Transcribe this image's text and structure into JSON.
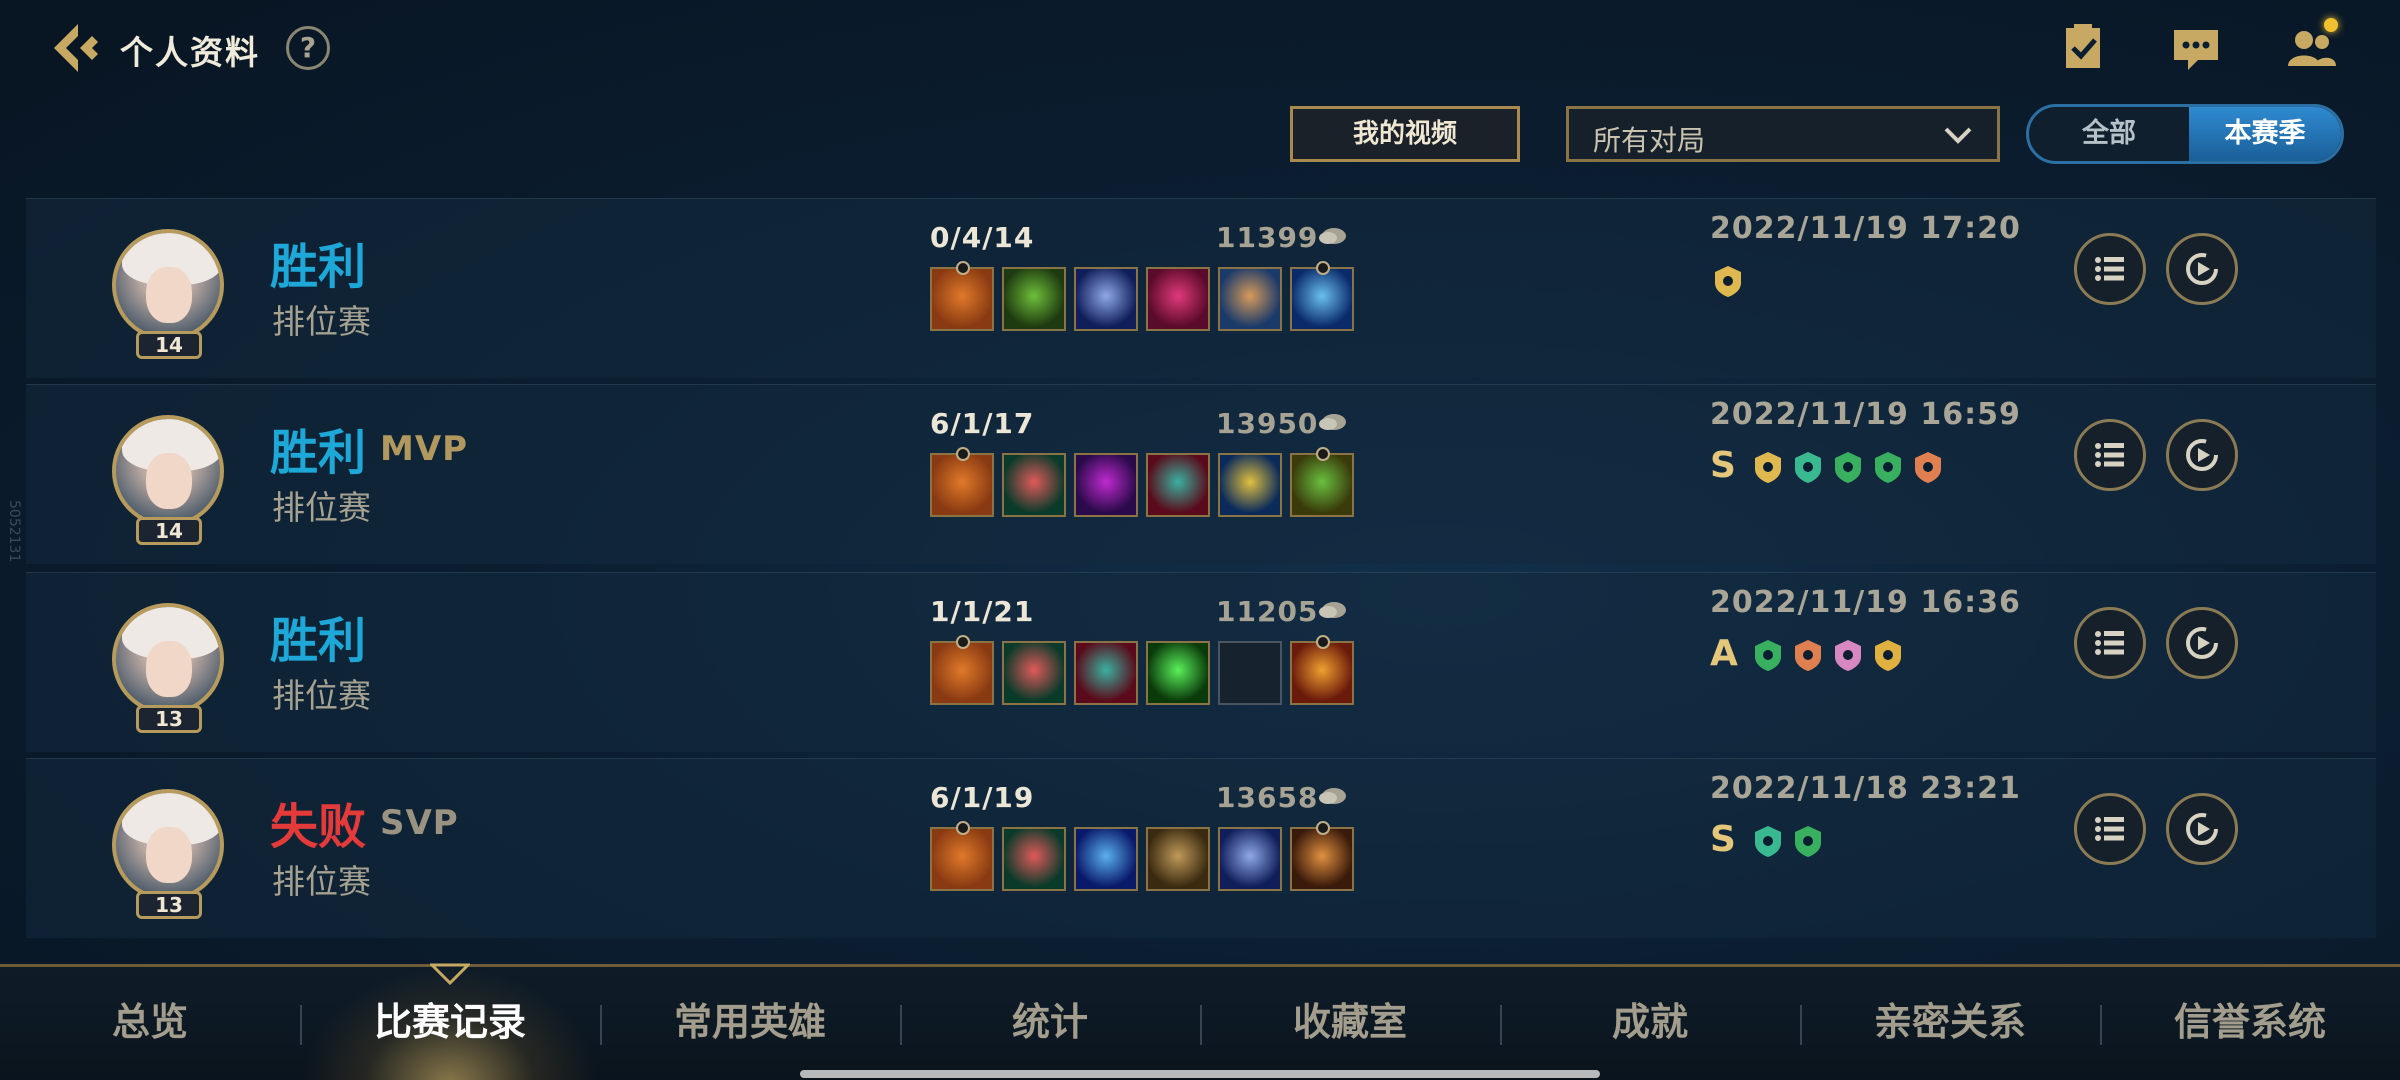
{
  "header": {
    "title": "个人资料",
    "help_label": "?"
  },
  "filters": {
    "my_videos_label": "我的视频",
    "match_type_selected": "所有对局",
    "segment": {
      "all_label": "全部",
      "season_label": "本赛季",
      "selected": "本赛季"
    }
  },
  "watermark": "5052131",
  "matches": [
    {
      "result": "胜利",
      "honor": "",
      "mode": "排位赛",
      "level": "14",
      "kda": "0/4/14",
      "gold": "11399",
      "time": "2022/11/19 17:20",
      "grade": "",
      "items": [
        "item-axe",
        "item-claw",
        "item-helm",
        "item-demon",
        "item-tome",
        "item-orb"
      ],
      "badges": [
        "gold-bee-badge"
      ]
    },
    {
      "result": "胜利",
      "honor": "MVP",
      "mode": "排位赛",
      "level": "14",
      "kda": "6/1/17",
      "gold": "13950",
      "time": "2022/11/19 16:59",
      "grade": "S",
      "items": [
        "item-axe",
        "item-boots",
        "item-mask",
        "item-beast",
        "item-trident",
        "item-scroll"
      ],
      "badges": [
        "gold-bee-badge",
        "green-shield-badge",
        "green-heart-badge",
        "green-armor-badge",
        "orange-tank-badge"
      ]
    },
    {
      "result": "胜利",
      "honor": "",
      "mode": "排位赛",
      "level": "13",
      "kda": "1/1/21",
      "gold": "11205",
      "time": "2022/11/19 16:36",
      "grade": "A",
      "items": [
        "item-axe",
        "item-boots",
        "item-beast",
        "item-skull-ring",
        "empty",
        "item-sunfire"
      ],
      "badges": [
        "green-heart-badge",
        "orange-tank-badge",
        "pink-wings-badge",
        "gold-drop-badge"
      ]
    },
    {
      "result": "失败",
      "honor": "SVP",
      "mode": "排位赛",
      "level": "13",
      "kda": "6/1/19",
      "gold": "13658",
      "time": "2022/11/18 23:21",
      "grade": "S",
      "items": [
        "item-axe",
        "item-boots",
        "item-crystal",
        "item-gauntlet",
        "item-helm",
        "item-lantern"
      ],
      "badges": [
        "green-shield-badge",
        "green-heart-badge"
      ]
    }
  ],
  "bottom_nav": {
    "tabs": [
      "总览",
      "比赛记录",
      "常用英雄",
      "统计",
      "收藏室",
      "成就",
      "亲密关系",
      "信誉系统"
    ],
    "active": "比赛记录"
  },
  "colors": {
    "win": "#1ea8d8",
    "lose": "#e43a3a",
    "gold_accent": "#b79b5c",
    "segment_active": "#2f8ad0"
  }
}
